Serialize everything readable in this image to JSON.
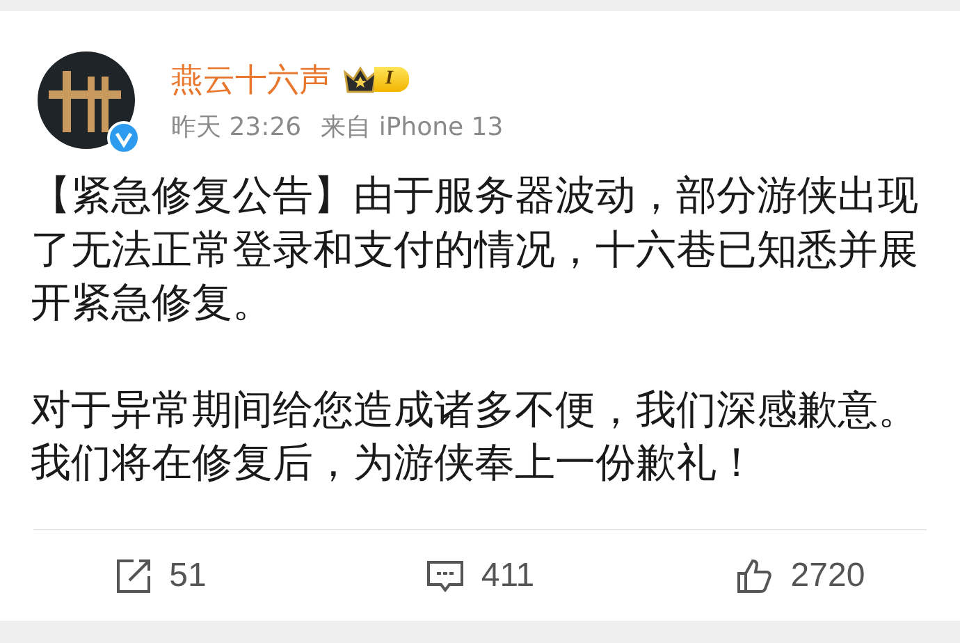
{
  "post": {
    "author": {
      "name": "燕云十六声",
      "verified": true,
      "level_badge": "I"
    },
    "time": "昨天 23:26",
    "source": "来自 iPhone 13",
    "paragraphs": [
      "【紧急修复公告】由于服务器波动，部分游侠出现了无法正常登录和支付的情况，十六巷已知悉并展开紧急修复。",
      "对于异常期间给您造成诸多不便，我们深感歉意。我们将在修复后，为游侠奉上一份歉礼！"
    ],
    "actions": [
      {
        "kind": "repost",
        "count": "51"
      },
      {
        "kind": "comment",
        "count": "411"
      },
      {
        "kind": "like",
        "count": "2720"
      }
    ]
  }
}
